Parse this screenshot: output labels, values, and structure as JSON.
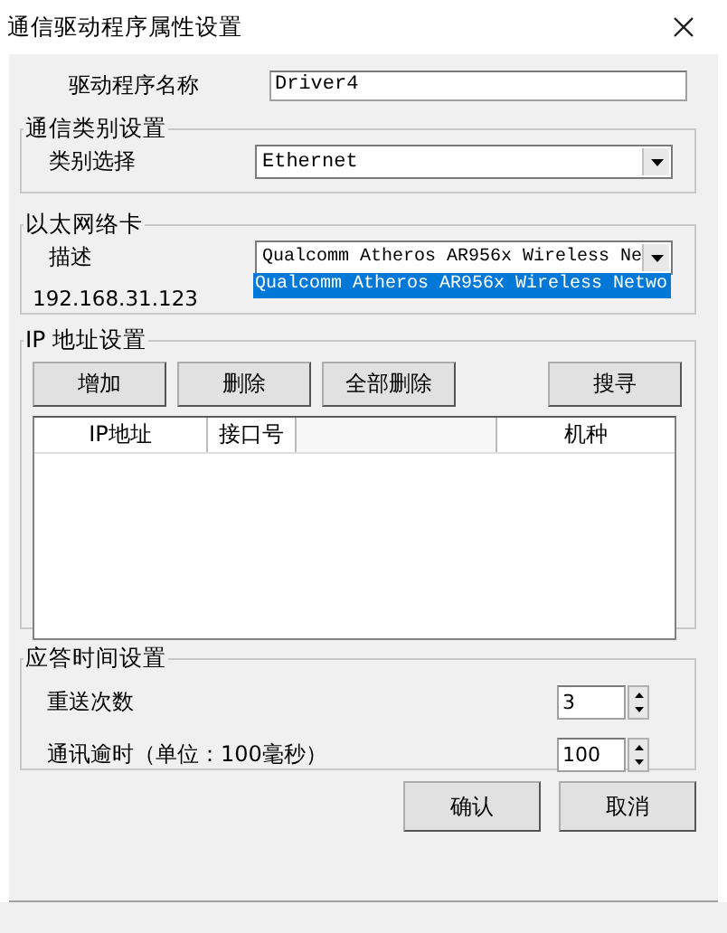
{
  "window": {
    "title": "通信驱动程序属性设置"
  },
  "driver_name": {
    "label": "驱动程序名称",
    "value": "Driver4"
  },
  "comm_type": {
    "title": "通信类别设置",
    "label": "类别选择",
    "value": "Ethernet"
  },
  "ethernet_card": {
    "title": "以太网络卡",
    "label": "描述",
    "value": "Qualcomm Atheros AR956x Wireless Ne",
    "ip": "192.168.31.123",
    "dropdown_options": [
      {
        "label": "Qualcomm Atheros AR956x Wireless Netwo",
        "selected": true
      }
    ]
  },
  "ip_settings": {
    "title": "IP 地址设置",
    "buttons": [
      "增加",
      "删除",
      "全部删除",
      "搜寻"
    ],
    "columns": [
      "IP地址",
      "接口号",
      "",
      "机种"
    ]
  },
  "response_time": {
    "title": "应答时间设置",
    "rows": [
      {
        "label": "重送次数",
        "value": "3"
      },
      {
        "label": "通讯逾时（单位：100毫秒）",
        "value": "100"
      }
    ]
  },
  "buttons": [
    "确认",
    "取消"
  ]
}
